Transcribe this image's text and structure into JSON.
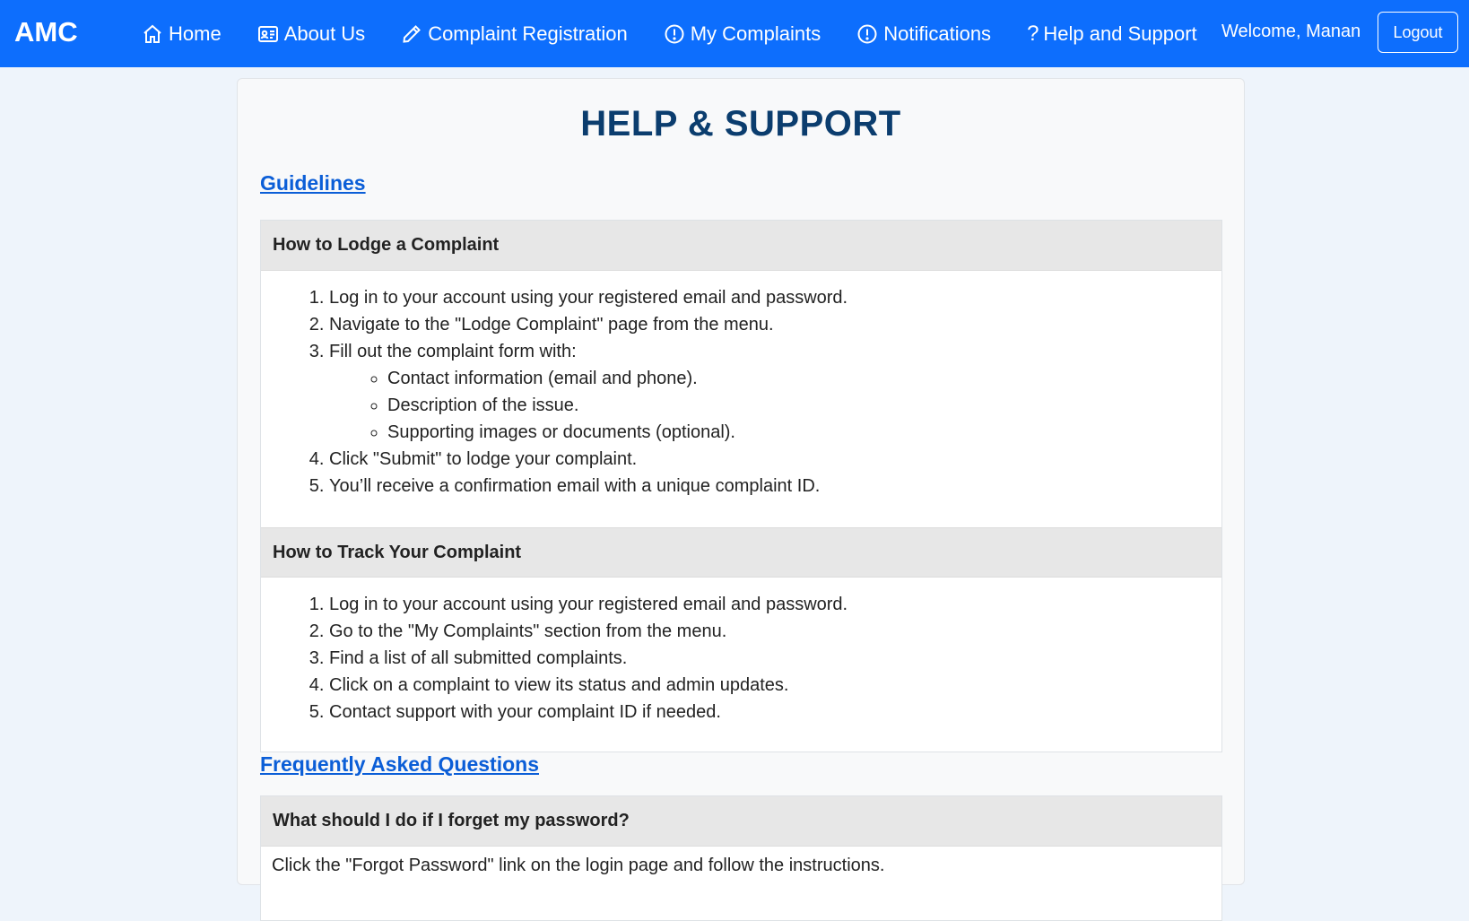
{
  "navbar": {
    "brand": "AMC",
    "items": [
      {
        "label": "Home",
        "icon": "home-icon"
      },
      {
        "label": "About Us",
        "icon": "id-card-icon"
      },
      {
        "label": "Complaint Registration",
        "icon": "pencil-icon"
      },
      {
        "label": "My Complaints",
        "icon": "exclamation-circle-icon"
      },
      {
        "label": "Notifications",
        "icon": "exclamation-circle-icon"
      },
      {
        "label": "Help and Support",
        "icon": "question-icon"
      }
    ],
    "welcome": "Welcome, Manan",
    "logout": "Logout"
  },
  "page": {
    "title": "HELP & SUPPORT",
    "guidelines_link": "Guidelines",
    "faq_link": "Frequently Asked Questions"
  },
  "guidelines": [
    {
      "header": "How to Lodge a Complaint",
      "steps": [
        "Log in to your account using your registered email and password.",
        "Navigate to the \"Lodge Complaint\" page from the menu.",
        "Fill out the complaint form with:",
        "Click \"Submit\" to lodge your complaint.",
        "You’ll receive a confirmation email with a unique complaint ID."
      ],
      "substeps": [
        "Contact information (email and phone).",
        "Description of the issue.",
        "Supporting images or documents (optional)."
      ]
    },
    {
      "header": "How to Track Your Complaint",
      "steps": [
        "Log in to your account using your registered email and password.",
        "Go to the \"My Complaints\" section from the menu.",
        "Find a list of all submitted complaints.",
        "Click on a complaint to view its status and admin updates.",
        "Contact support with your complaint ID if needed."
      ]
    }
  ],
  "faq": [
    {
      "question": "What should I do if I forget my password?",
      "answer": "Click the \"Forgot Password\" link on the login page and follow the instructions."
    }
  ],
  "colors": {
    "navbar": "#0d6efd",
    "title": "#0b3d6e",
    "link": "#0b5ed7",
    "accordion_header": "#e7e7e7"
  }
}
